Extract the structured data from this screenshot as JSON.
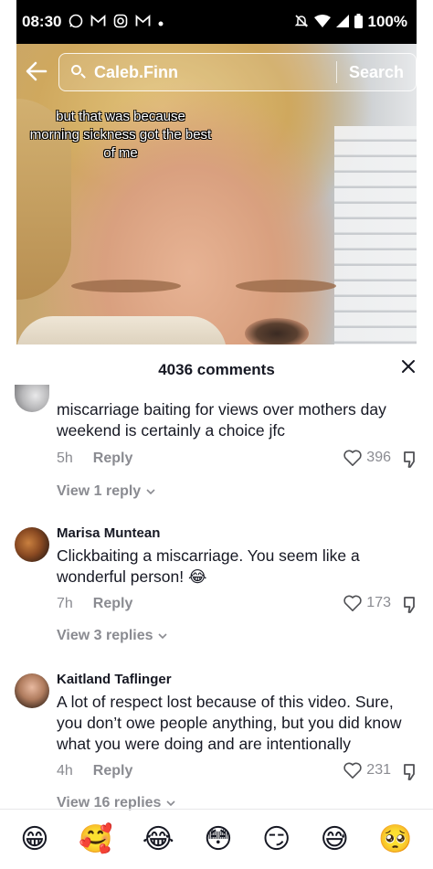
{
  "status_bar": {
    "time": "08:30",
    "battery": "100%",
    "left_icons": [
      "whatsapp-icon",
      "gmail-icon",
      "instagram-icon",
      "gmail-icon"
    ],
    "right_icons": [
      "mute-icon",
      "wifi-icon",
      "signal-icon",
      "battery-icon"
    ]
  },
  "search": {
    "query": "Caleb.Finn",
    "button_label": "Search"
  },
  "video": {
    "caption": "but that was because morning sickness got the best of me"
  },
  "comments_panel": {
    "title": "4036 comments",
    "comments": [
      {
        "author": "",
        "text": "miscarriage baiting for views over mothers day weekend is certainly a choice jfc",
        "time": "5h",
        "reply_label": "Reply",
        "likes": "396",
        "view_replies": "View 1 reply"
      },
      {
        "author": "Marisa Muntean",
        "text": "Clickbaiting a miscarriage. You seem like a wonderful person! 😂",
        "time": "7h",
        "reply_label": "Reply",
        "likes": "173",
        "view_replies": "View 3 replies"
      },
      {
        "author": "Kaitland Taflinger",
        "text": "A lot of respect lost because of this video. Sure, you don’t owe people anything, but you did know what you were doing and are intentionally",
        "time": "4h",
        "reply_label": "Reply",
        "likes": "231",
        "view_replies": "View 16 replies"
      }
    ]
  },
  "emoji_bar": [
    "😁",
    "🥰",
    "😂",
    "😳",
    "😏",
    "😅",
    "🥺"
  ],
  "colors": {
    "text_primary": "#161823",
    "text_secondary": "#8a8b91",
    "status_bar_bg": "#000000"
  }
}
